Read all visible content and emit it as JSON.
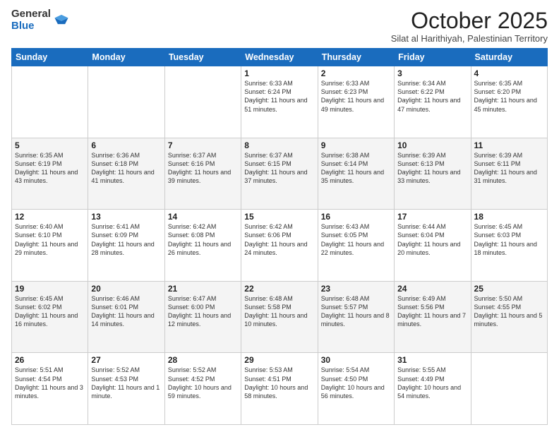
{
  "header": {
    "logo": {
      "general": "General",
      "blue": "Blue"
    },
    "month": "October 2025",
    "location": "Silat al Harithiyah, Palestinian Territory"
  },
  "weekdays": [
    "Sunday",
    "Monday",
    "Tuesday",
    "Wednesday",
    "Thursday",
    "Friday",
    "Saturday"
  ],
  "weeks": [
    [
      {
        "day": "",
        "sunrise": "",
        "sunset": "",
        "daylight": ""
      },
      {
        "day": "",
        "sunrise": "",
        "sunset": "",
        "daylight": ""
      },
      {
        "day": "",
        "sunrise": "",
        "sunset": "",
        "daylight": ""
      },
      {
        "day": "1",
        "sunrise": "6:33 AM",
        "sunset": "6:24 PM",
        "daylight": "11 hours and 51 minutes."
      },
      {
        "day": "2",
        "sunrise": "6:33 AM",
        "sunset": "6:23 PM",
        "daylight": "11 hours and 49 minutes."
      },
      {
        "day": "3",
        "sunrise": "6:34 AM",
        "sunset": "6:22 PM",
        "daylight": "11 hours and 47 minutes."
      },
      {
        "day": "4",
        "sunrise": "6:35 AM",
        "sunset": "6:20 PM",
        "daylight": "11 hours and 45 minutes."
      }
    ],
    [
      {
        "day": "5",
        "sunrise": "6:35 AM",
        "sunset": "6:19 PM",
        "daylight": "11 hours and 43 minutes."
      },
      {
        "day": "6",
        "sunrise": "6:36 AM",
        "sunset": "6:18 PM",
        "daylight": "11 hours and 41 minutes."
      },
      {
        "day": "7",
        "sunrise": "6:37 AM",
        "sunset": "6:16 PM",
        "daylight": "11 hours and 39 minutes."
      },
      {
        "day": "8",
        "sunrise": "6:37 AM",
        "sunset": "6:15 PM",
        "daylight": "11 hours and 37 minutes."
      },
      {
        "day": "9",
        "sunrise": "6:38 AM",
        "sunset": "6:14 PM",
        "daylight": "11 hours and 35 minutes."
      },
      {
        "day": "10",
        "sunrise": "6:39 AM",
        "sunset": "6:13 PM",
        "daylight": "11 hours and 33 minutes."
      },
      {
        "day": "11",
        "sunrise": "6:39 AM",
        "sunset": "6:11 PM",
        "daylight": "11 hours and 31 minutes."
      }
    ],
    [
      {
        "day": "12",
        "sunrise": "6:40 AM",
        "sunset": "6:10 PM",
        "daylight": "11 hours and 29 minutes."
      },
      {
        "day": "13",
        "sunrise": "6:41 AM",
        "sunset": "6:09 PM",
        "daylight": "11 hours and 28 minutes."
      },
      {
        "day": "14",
        "sunrise": "6:42 AM",
        "sunset": "6:08 PM",
        "daylight": "11 hours and 26 minutes."
      },
      {
        "day": "15",
        "sunrise": "6:42 AM",
        "sunset": "6:06 PM",
        "daylight": "11 hours and 24 minutes."
      },
      {
        "day": "16",
        "sunrise": "6:43 AM",
        "sunset": "6:05 PM",
        "daylight": "11 hours and 22 minutes."
      },
      {
        "day": "17",
        "sunrise": "6:44 AM",
        "sunset": "6:04 PM",
        "daylight": "11 hours and 20 minutes."
      },
      {
        "day": "18",
        "sunrise": "6:45 AM",
        "sunset": "6:03 PM",
        "daylight": "11 hours and 18 minutes."
      }
    ],
    [
      {
        "day": "19",
        "sunrise": "6:45 AM",
        "sunset": "6:02 PM",
        "daylight": "11 hours and 16 minutes."
      },
      {
        "day": "20",
        "sunrise": "6:46 AM",
        "sunset": "6:01 PM",
        "daylight": "11 hours and 14 minutes."
      },
      {
        "day": "21",
        "sunrise": "6:47 AM",
        "sunset": "6:00 PM",
        "daylight": "11 hours and 12 minutes."
      },
      {
        "day": "22",
        "sunrise": "6:48 AM",
        "sunset": "5:58 PM",
        "daylight": "11 hours and 10 minutes."
      },
      {
        "day": "23",
        "sunrise": "6:48 AM",
        "sunset": "5:57 PM",
        "daylight": "11 hours and 8 minutes."
      },
      {
        "day": "24",
        "sunrise": "6:49 AM",
        "sunset": "5:56 PM",
        "daylight": "11 hours and 7 minutes."
      },
      {
        "day": "25",
        "sunrise": "5:50 AM",
        "sunset": "4:55 PM",
        "daylight": "11 hours and 5 minutes."
      }
    ],
    [
      {
        "day": "26",
        "sunrise": "5:51 AM",
        "sunset": "4:54 PM",
        "daylight": "11 hours and 3 minutes."
      },
      {
        "day": "27",
        "sunrise": "5:52 AM",
        "sunset": "4:53 PM",
        "daylight": "11 hours and 1 minute."
      },
      {
        "day": "28",
        "sunrise": "5:52 AM",
        "sunset": "4:52 PM",
        "daylight": "10 hours and 59 minutes."
      },
      {
        "day": "29",
        "sunrise": "5:53 AM",
        "sunset": "4:51 PM",
        "daylight": "10 hours and 58 minutes."
      },
      {
        "day": "30",
        "sunrise": "5:54 AM",
        "sunset": "4:50 PM",
        "daylight": "10 hours and 56 minutes."
      },
      {
        "day": "31",
        "sunrise": "5:55 AM",
        "sunset": "4:49 PM",
        "daylight": "10 hours and 54 minutes."
      },
      {
        "day": "",
        "sunrise": "",
        "sunset": "",
        "daylight": ""
      }
    ]
  ]
}
